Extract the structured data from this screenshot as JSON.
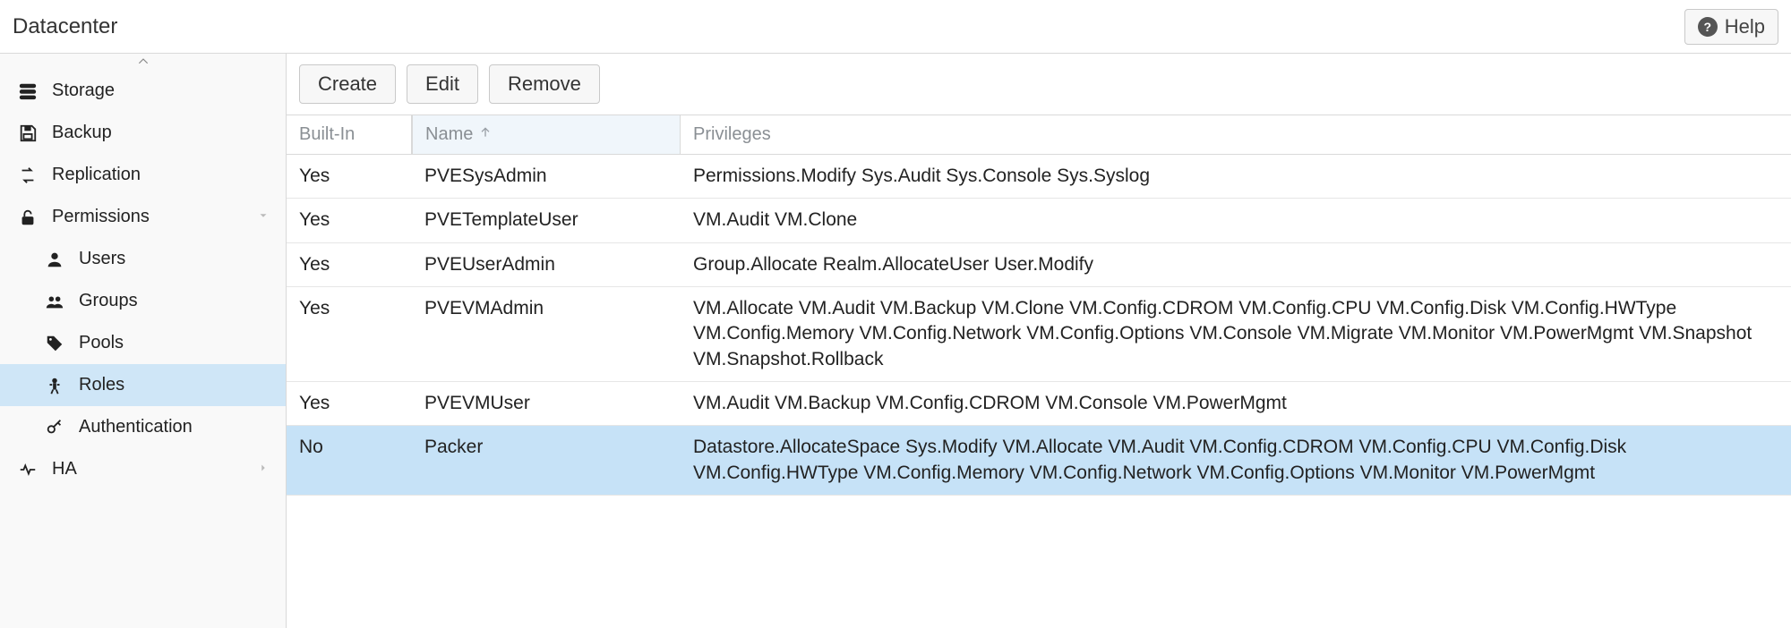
{
  "header": {
    "title": "Datacenter",
    "help": "Help"
  },
  "sidebar": {
    "items": [
      {
        "icon": "storage-icon",
        "label": "Storage",
        "sub": false
      },
      {
        "icon": "save-icon",
        "label": "Backup",
        "sub": false
      },
      {
        "icon": "replication-icon",
        "label": "Replication",
        "sub": false
      },
      {
        "icon": "unlock-icon",
        "label": "Permissions",
        "sub": false,
        "expandable": true
      },
      {
        "icon": "user-icon",
        "label": "Users",
        "sub": true
      },
      {
        "icon": "group-icon",
        "label": "Groups",
        "sub": true
      },
      {
        "icon": "tags-icon",
        "label": "Pools",
        "sub": true
      },
      {
        "icon": "person-icon",
        "label": "Roles",
        "sub": true,
        "selected": true
      },
      {
        "icon": "key-icon",
        "label": "Authentication",
        "sub": true
      },
      {
        "icon": "heartbeat-icon",
        "label": "HA",
        "sub": false,
        "expandable": true
      }
    ]
  },
  "toolbar": {
    "create": "Create",
    "edit": "Edit",
    "remove": "Remove"
  },
  "columns": {
    "builtin": "Built-In",
    "name": "Name",
    "privileges": "Privileges",
    "sort": "asc"
  },
  "rows": [
    {
      "builtin": "Yes",
      "name": "PVESysAdmin",
      "privileges": "Permissions.Modify Sys.Audit Sys.Console Sys.Syslog"
    },
    {
      "builtin": "Yes",
      "name": "PVETemplateUser",
      "privileges": "VM.Audit VM.Clone"
    },
    {
      "builtin": "Yes",
      "name": "PVEUserAdmin",
      "privileges": "Group.Allocate Realm.AllocateUser User.Modify"
    },
    {
      "builtin": "Yes",
      "name": "PVEVMAdmin",
      "privileges": "VM.Allocate VM.Audit VM.Backup VM.Clone VM.Config.CDROM VM.Config.CPU VM.Config.Disk VM.Config.HWType VM.Config.Memory VM.Config.Network VM.Config.Options VM.Console VM.Migrate VM.Monitor VM.PowerMgmt VM.Snapshot VM.Snapshot.Rollback"
    },
    {
      "builtin": "Yes",
      "name": "PVEVMUser",
      "privileges": "VM.Audit VM.Backup VM.Config.CDROM VM.Console VM.PowerMgmt"
    },
    {
      "builtin": "No",
      "name": "Packer",
      "privileges": "Datastore.AllocateSpace Sys.Modify VM.Allocate VM.Audit VM.Config.CDROM VM.Config.CPU VM.Config.Disk VM.Config.HWType VM.Config.Memory VM.Config.Network VM.Config.Options VM.Monitor VM.PowerMgmt",
      "selected": true
    }
  ]
}
